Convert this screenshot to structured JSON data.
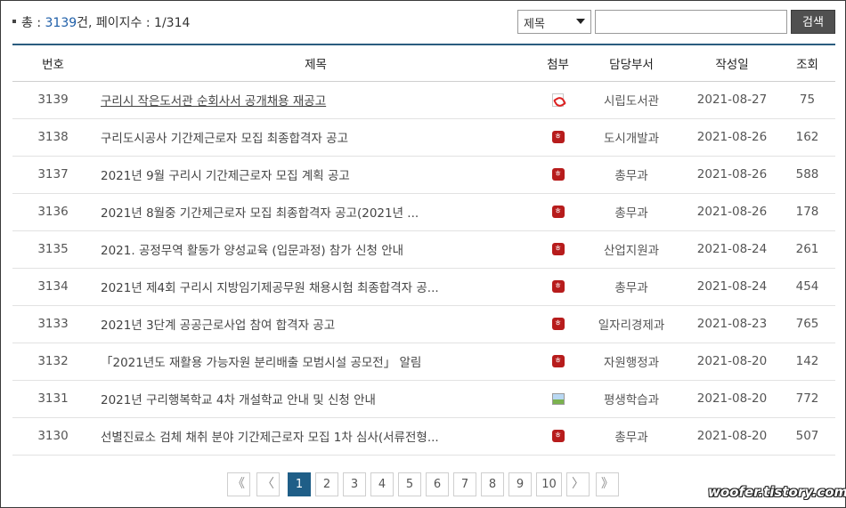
{
  "summary": {
    "prefix": "총 : ",
    "total": "3139",
    "suffix": "건, 페이지수 : 1/314"
  },
  "search": {
    "select_value": "제목",
    "input_value": "",
    "button_label": "검색"
  },
  "table": {
    "headers": [
      "번호",
      "제목",
      "첨부",
      "담당부서",
      "작성일",
      "조회"
    ],
    "rows": [
      {
        "no": "3139",
        "title": "구리시 작은도서관 순회사서 공개채용 재공고",
        "attachment": "pdf-icon",
        "dept": "시립도서관",
        "date": "2021-08-27",
        "views": "75"
      },
      {
        "no": "3138",
        "title": "구리도시공사 기간제근로자 모집 최종합격자 공고",
        "attachment": "hwp-icon",
        "dept": "도시개발과",
        "date": "2021-08-26",
        "views": "162"
      },
      {
        "no": "3137",
        "title": "2021년 9월 구리시 기간제근로자 모집 계획 공고",
        "attachment": "hwp-icon",
        "dept": "총무과",
        "date": "2021-08-26",
        "views": "588"
      },
      {
        "no": "3136",
        "title": "2021년 8월중 기간제근로자 모집 최종합격자 공고(2021년 ...",
        "attachment": "hwp-icon",
        "dept": "총무과",
        "date": "2021-08-26",
        "views": "178"
      },
      {
        "no": "3135",
        "title": "2021. 공정무역 활동가 양성교육 (입문과정) 참가 신청 안내",
        "attachment": "hwp-icon",
        "dept": "산업지원과",
        "date": "2021-08-24",
        "views": "261"
      },
      {
        "no": "3134",
        "title": "2021년 제4회 구리시 지방임기제공무원 채용시험 최종합격자 공...",
        "attachment": "hwp-icon",
        "dept": "총무과",
        "date": "2021-08-24",
        "views": "454"
      },
      {
        "no": "3133",
        "title": "2021년 3단계 공공근로사업 참여 합격자 공고",
        "attachment": "hwp-icon",
        "dept": "일자리경제과",
        "date": "2021-08-23",
        "views": "765"
      },
      {
        "no": "3132",
        "title": "「2021년도 재활용 가능자원 분리배출 모범시설 공모전」 알림",
        "attachment": "hwp-icon",
        "dept": "자원행정과",
        "date": "2021-08-20",
        "views": "142"
      },
      {
        "no": "3131",
        "title": "2021년 구리행복학교 4차 개설학교 안내 및 신청 안내",
        "attachment": "image-icon",
        "dept": "평생학습과",
        "date": "2021-08-20",
        "views": "772"
      },
      {
        "no": "3130",
        "title": "선별진료소 검체 채취 분야 기간제근로자 모집 1차 심사(서류전형...",
        "attachment": "hwp-icon",
        "dept": "총무과",
        "date": "2021-08-20",
        "views": "507"
      }
    ]
  },
  "pagination": {
    "first": "《",
    "prev": "〈",
    "pages": [
      "1",
      "2",
      "3",
      "4",
      "5",
      "6",
      "7",
      "8",
      "9",
      "10"
    ],
    "current": "1",
    "next": "〉",
    "last": "》"
  },
  "watermark": "woofer.tistory.com",
  "colors": {
    "accent": "#1f5e87",
    "total_count": "#1e5ea8",
    "search_button": "#505050",
    "hwp_icon": "#b71c1c"
  }
}
